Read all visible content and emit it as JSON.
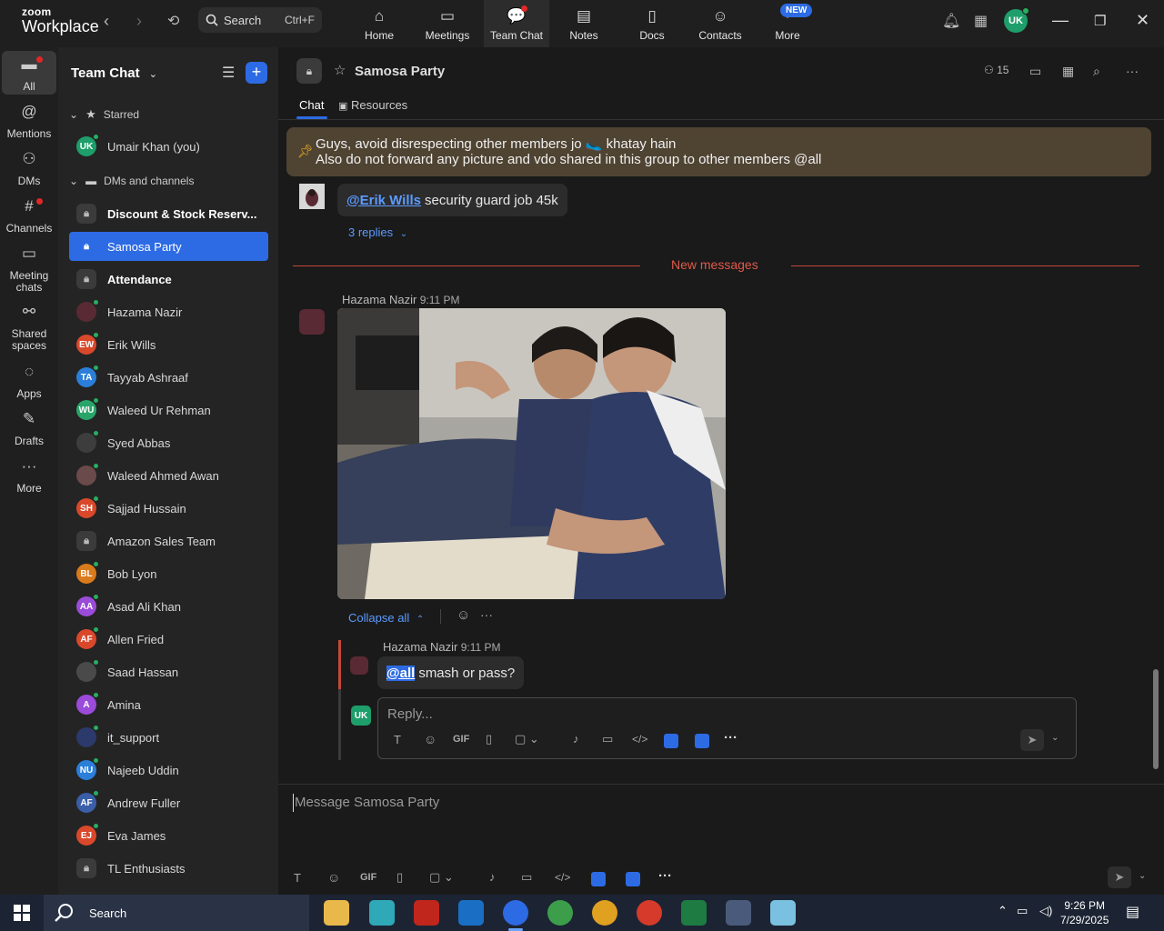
{
  "app": {
    "brand_top": "zoom",
    "brand_bottom": "Workplace"
  },
  "topbar": {
    "search_label": "Search",
    "search_shortcut": "Ctrl+F",
    "tabs": [
      {
        "label": "Home",
        "icon": "home-icon"
      },
      {
        "label": "Meetings",
        "icon": "video-camera-icon"
      },
      {
        "label": "Team Chat",
        "icon": "chat-icon"
      },
      {
        "label": "Notes",
        "icon": "notes-icon"
      },
      {
        "label": "Docs",
        "icon": "docs-icon"
      },
      {
        "label": "Contacts",
        "icon": "contacts-icon"
      },
      {
        "label": "More",
        "icon": "more-icon"
      }
    ],
    "new_badge": "NEW",
    "user_initials": "UK"
  },
  "rail": {
    "items": [
      {
        "label": "All",
        "icon": "chat-bubble-icon"
      },
      {
        "label": "Mentions",
        "icon": "at-icon"
      },
      {
        "label": "DMs",
        "icon": "people-icon"
      },
      {
        "label": "Channels",
        "icon": "hash-icon"
      },
      {
        "label": "Meeting chats",
        "icon": "calendar-icon"
      },
      {
        "label": "Shared spaces",
        "icon": "share-icon"
      },
      {
        "label": "Apps",
        "icon": "apps-icon"
      },
      {
        "label": "Drafts",
        "icon": "drafts-icon"
      },
      {
        "label": "More",
        "icon": "ellipsis-icon"
      }
    ]
  },
  "sidebar": {
    "title": "Team Chat",
    "sections": {
      "starred": "Starred",
      "dms": "DMs and channels"
    },
    "starred": [
      {
        "label": "Umair Khan (you)",
        "initials": "UK",
        "color": "#1e9e6a"
      }
    ],
    "items": [
      {
        "label": "Discount & Stock Reserv...",
        "type": "lock",
        "bold": true
      },
      {
        "label": "Samosa Party",
        "type": "lock",
        "selected": true
      },
      {
        "label": "Attendance",
        "type": "lock",
        "bold": true
      },
      {
        "label": "Hazama Nazir",
        "type": "photo",
        "color": "#5a2a34"
      },
      {
        "label": "Erik Wills",
        "initials": "EW",
        "color": "#d9482b"
      },
      {
        "label": "Tayyab Ashraaf",
        "initials": "TA",
        "color": "#2b7fd9"
      },
      {
        "label": "Waleed Ur Rehman",
        "initials": "WU",
        "color": "#2aa56a"
      },
      {
        "label": "Syed Abbas",
        "type": "photo",
        "color": "#3d3d3d"
      },
      {
        "label": "Waleed Ahmed Awan",
        "type": "photo",
        "color": "#6a4a4a"
      },
      {
        "label": "Sajjad Hussain",
        "initials": "SH",
        "color": "#d9482b"
      },
      {
        "label": "Amazon Sales Team",
        "type": "lock"
      },
      {
        "label": "Bob Lyon",
        "initials": "BL",
        "color": "#d97a1b"
      },
      {
        "label": "Asad Ali Khan",
        "initials": "AA",
        "color": "#9b4bd9"
      },
      {
        "label": "Allen Fried",
        "initials": "AF",
        "color": "#d9482b"
      },
      {
        "label": "Saad Hassan",
        "type": "photo",
        "color": "#4a4a4a"
      },
      {
        "label": "Amina",
        "initials": "A",
        "color": "#9b4bd9"
      },
      {
        "label": "it_support",
        "type": "photo",
        "color": "#2b3a6a"
      },
      {
        "label": "Najeeb Uddin",
        "initials": "NU",
        "color": "#2b7fd9"
      },
      {
        "label": "Andrew Fuller",
        "initials": "AF",
        "color": "#3a5ea8"
      },
      {
        "label": "Eva James",
        "initials": "EJ",
        "color": "#d9482b"
      },
      {
        "label": "TL Enthusiasts",
        "type": "lock"
      }
    ]
  },
  "channel": {
    "title": "Samosa Party",
    "member_count": "15",
    "tabs": {
      "chat": "Chat",
      "resources": "Resources"
    }
  },
  "pinned": {
    "line1": "Guys, avoid disrespecting other members jo 🥿 khatay hain",
    "line2": "Also do not forward any picture and vdo shared in this group to other members @all"
  },
  "messages": {
    "first": {
      "mention": "@Erik Wills",
      "text": "security guard job 45k",
      "replies": "3 replies"
    },
    "new_messages": "New messages",
    "photo_post": {
      "author": "Hazama Nazir",
      "time": "9:11 PM"
    },
    "collapse": "Collapse all",
    "reply": {
      "author": "Hazama Nazir",
      "time": "9:11 PM",
      "mention": "@all",
      "text": "smash or pass?"
    }
  },
  "thread_composer": {
    "placeholder": "Reply...",
    "avatar": "UK"
  },
  "composer": {
    "placeholder": "Message Samosa Party"
  },
  "taskbar": {
    "search": "Search",
    "time": "9:26 PM",
    "date": "7/29/2025"
  },
  "colors": {
    "accent": "#2d6be4",
    "pinned_bg": "#4f4332",
    "new_messages": "#e0594b"
  }
}
